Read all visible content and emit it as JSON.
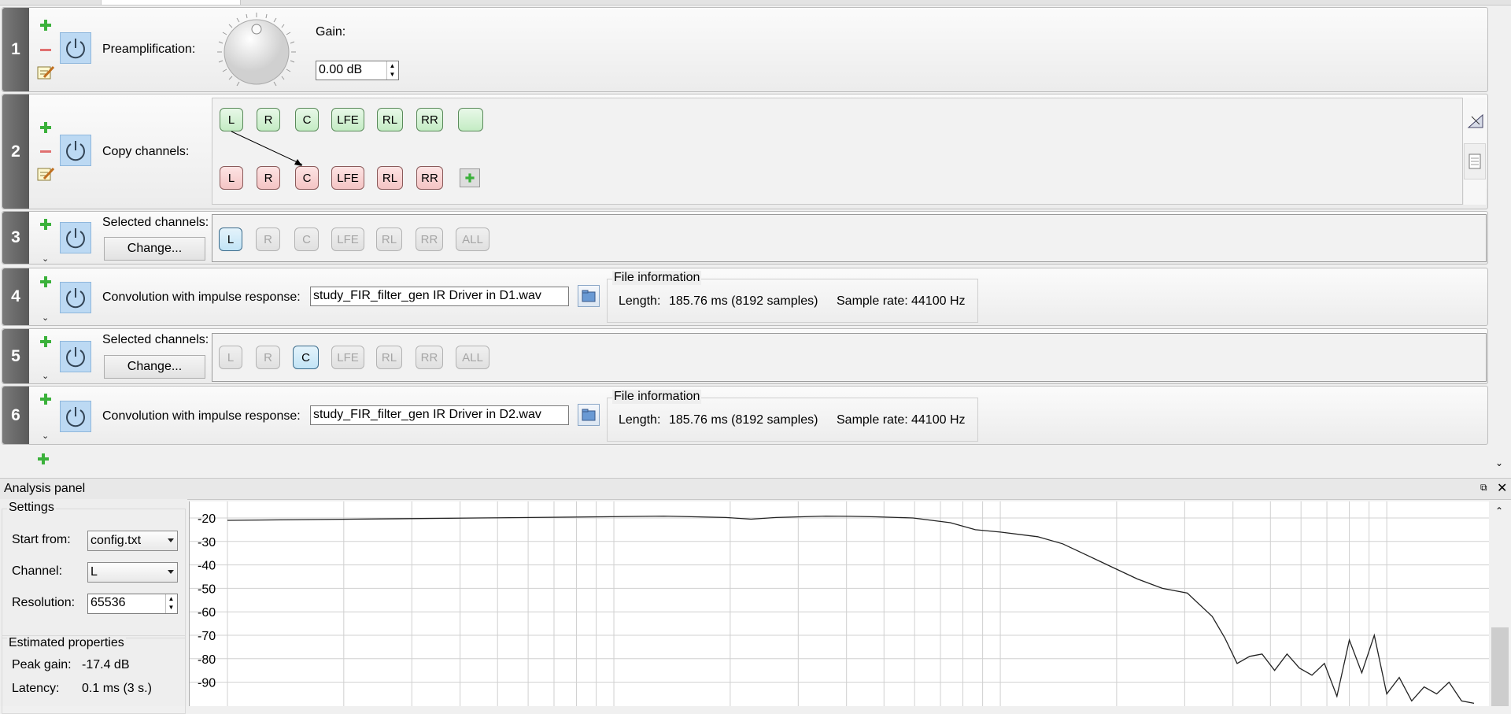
{
  "filters": [
    {
      "number": "1",
      "label": "Preamplification:",
      "gain_label": "Gain:",
      "gain_value": "0.00 dB"
    },
    {
      "number": "2",
      "label": "Copy channels:",
      "source_channels": [
        "L",
        "R",
        "C",
        "LFE",
        "RL",
        "RR",
        ""
      ],
      "target_channels": [
        "L",
        "R",
        "C",
        "LFE",
        "RL",
        "RR"
      ]
    },
    {
      "number": "3",
      "label": "Selected channels:",
      "change_label": "Change...",
      "channels": [
        "L",
        "R",
        "C",
        "LFE",
        "RL",
        "RR",
        "ALL"
      ],
      "selected": "L"
    },
    {
      "number": "4",
      "label": "Convolution with impulse response:",
      "file": "study_FIR_filter_gen IR Driver in D1.wav",
      "info_title": "File information",
      "length_label": "Length:",
      "length_value": "185.76 ms (8192 samples)",
      "rate_label": "Sample rate:",
      "rate_value": "44100 Hz"
    },
    {
      "number": "5",
      "label": "Selected channels:",
      "change_label": "Change...",
      "channels": [
        "L",
        "R",
        "C",
        "LFE",
        "RL",
        "RR",
        "ALL"
      ],
      "selected": "C"
    },
    {
      "number": "6",
      "label": "Convolution with impulse response:",
      "file": "study_FIR_filter_gen IR Driver in D2.wav",
      "info_title": "File information",
      "length_label": "Length:",
      "length_value": "185.76 ms (8192 samples)",
      "rate_label": "Sample rate:",
      "rate_value": "44100 Hz"
    }
  ],
  "analysis": {
    "title": "Analysis panel",
    "settings_title": "Settings",
    "start_from_label": "Start from:",
    "start_from_value": "config.txt",
    "channel_label": "Channel:",
    "channel_value": "L",
    "resolution_label": "Resolution:",
    "resolution_value": "65536",
    "estimated_title": "Estimated properties",
    "peak_gain_label": "Peak gain:",
    "peak_gain_value": "-17.4 dB",
    "latency_label": "Latency:",
    "latency_value": "0.1 ms (3 s.)"
  },
  "chart_data": {
    "type": "line",
    "y_ticks": [
      "-20",
      "-30",
      "-40",
      "-50",
      "-60",
      "-70",
      "-80",
      "-90"
    ],
    "ylim": [
      -97,
      -16
    ],
    "grid": true,
    "series": [
      {
        "x": [
          0,
          0.1,
          0.2,
          0.3,
          0.35,
          0.4,
          0.42,
          0.44,
          0.46,
          0.48,
          0.5,
          0.52,
          0.55,
          0.58,
          0.6,
          0.62,
          0.65,
          0.67,
          0.69,
          0.71,
          0.73,
          0.75,
          0.77,
          0.79,
          0.8,
          0.81,
          0.82,
          0.83,
          0.84,
          0.85,
          0.86,
          0.87,
          0.88,
          0.89,
          0.9,
          0.91,
          0.92,
          0.93,
          0.94,
          0.95,
          0.96,
          0.97,
          0.98,
          0.99,
          1.0
        ],
        "y": [
          -21,
          -20.5,
          -20,
          -19.5,
          -19.2,
          -19.8,
          -20.5,
          -19.8,
          -19.5,
          -19.2,
          -19.3,
          -19.5,
          -20,
          -22,
          -25,
          -26,
          -28,
          -31,
          -36,
          -41,
          -46,
          -50,
          -52,
          -62,
          -71,
          -82,
          -79,
          -78,
          -85,
          -78,
          -84,
          -87,
          -82,
          -96,
          -72,
          -86,
          -70,
          -95,
          -88,
          -98,
          -92,
          -95,
          -90,
          -98,
          -99
        ]
      }
    ]
  }
}
